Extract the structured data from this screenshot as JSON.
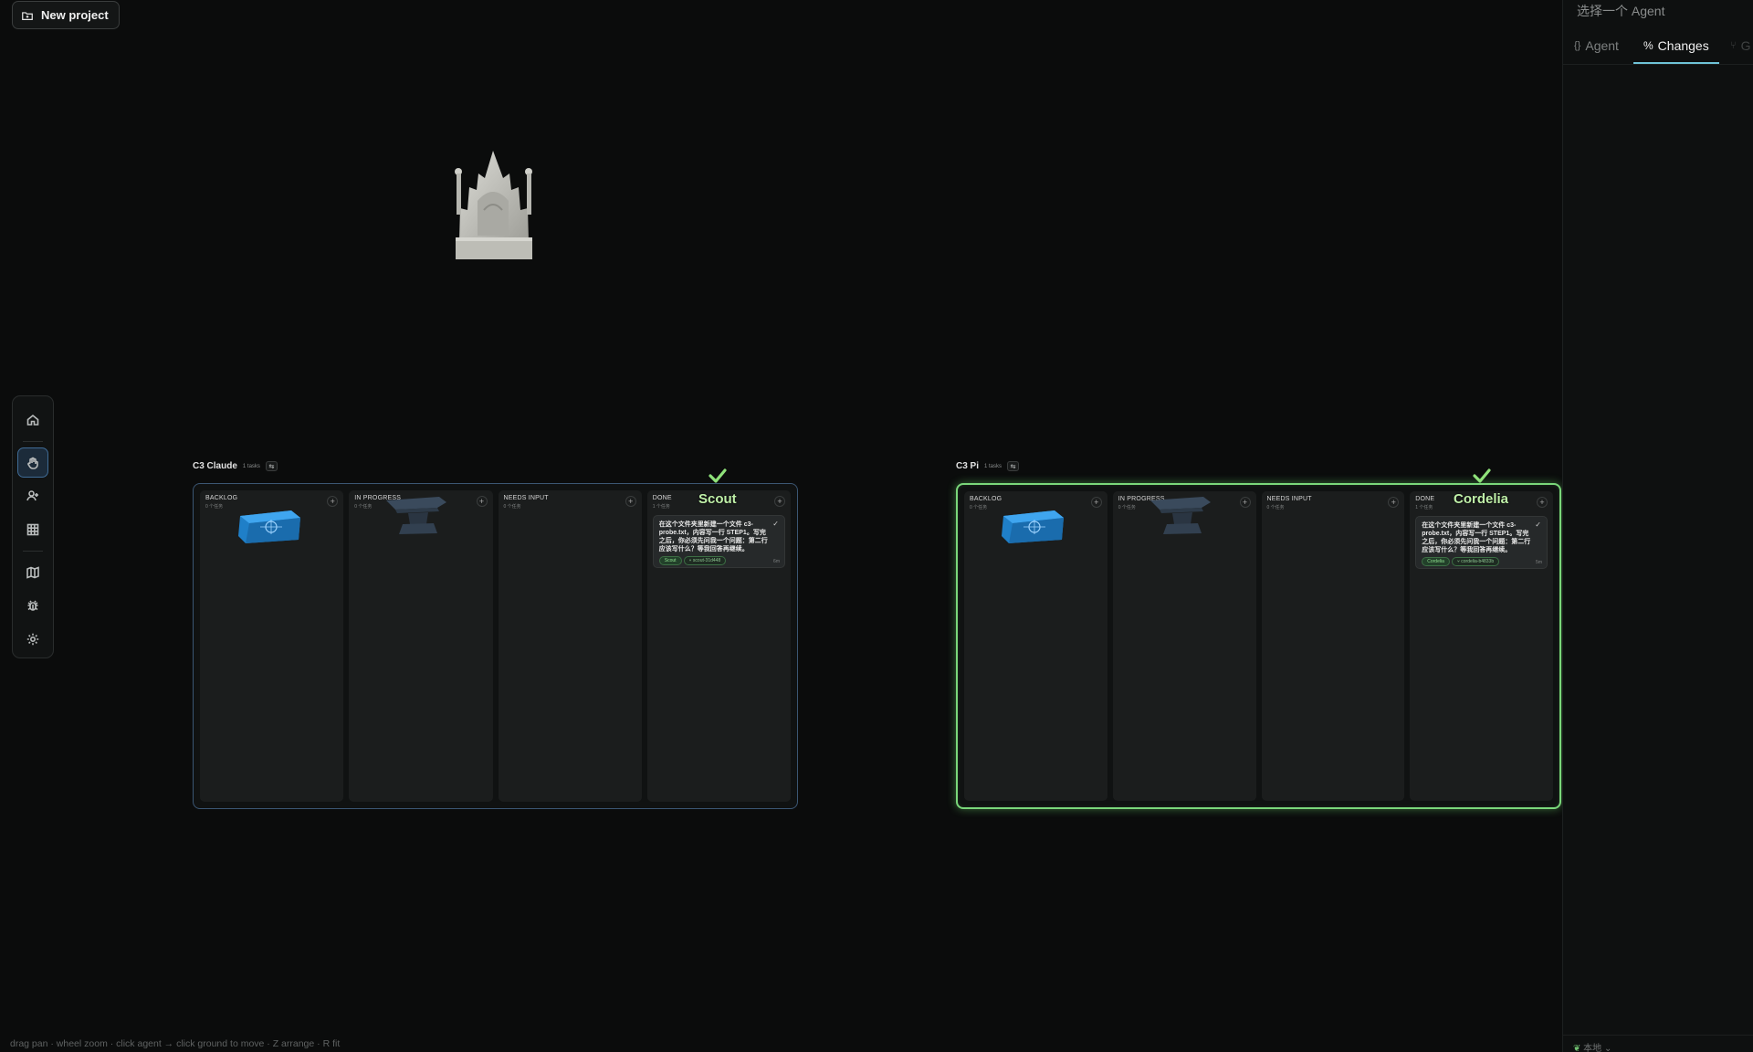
{
  "toolbar": {
    "new_project_label": "New project"
  },
  "tools": [
    {
      "name": "home"
    },
    {
      "name": "hand"
    },
    {
      "name": "add-agent"
    },
    {
      "name": "grid"
    },
    {
      "name": "map"
    },
    {
      "name": "bug"
    },
    {
      "name": "settings"
    }
  ],
  "boards": [
    {
      "title": "C3 Claude",
      "task_count": "1 tasks",
      "columns": [
        {
          "title": "BACKLOG",
          "sub": "0 个任务"
        },
        {
          "title": "IN PROGRESS",
          "sub": "0 个任务"
        },
        {
          "title": "NEEDS INPUT",
          "sub": "0 个任务"
        },
        {
          "title": "DONE",
          "sub": "1 个任务"
        }
      ],
      "agent": "Scout",
      "card": {
        "text": "在这个文件夹里新建一个文件 c3-probe.txt，内容写一行 STEP1。写完之后，你必须先问我一个问题：第二行应该写什么？等我回答再继续。",
        "agent_tag": "Scout",
        "branch_tag": "⑂ scout-31d448",
        "time": "6m"
      }
    },
    {
      "title": "C3 Pi",
      "task_count": "1 tasks",
      "columns": [
        {
          "title": "BACKLOG",
          "sub": "0 个任务"
        },
        {
          "title": "IN PROGRESS",
          "sub": "0 个任务"
        },
        {
          "title": "NEEDS INPUT",
          "sub": "0 个任务"
        },
        {
          "title": "DONE",
          "sub": "1 个任务"
        }
      ],
      "agent": "Cordelia",
      "card": {
        "text": "在这个文件夹里新建一个文件 c3-probe.txt，内容写一行 STEP1。写完之后，你必须先问我一个问题：第二行应该写什么？等我回答再继续。",
        "agent_tag": "Cordelia",
        "branch_tag": "⑂ cordelia-b4833b",
        "time": "5m"
      }
    }
  ],
  "right_panel": {
    "title": "选择一个 Agent",
    "tabs": [
      {
        "label": "Agent",
        "icon": "braces-icon"
      },
      {
        "label": "Changes",
        "icon": "diff-icon"
      },
      {
        "label": "G",
        "icon": "git-icon"
      }
    ],
    "active_tab": "Changes",
    "footer": "本地"
  },
  "hint": "drag pan · wheel zoom · click agent → click ground to move · Z arrange · R fit",
  "colors": {
    "accent_green": "#7ad77a",
    "accent_blue": "#3f6b96",
    "tab_underline": "#6fc3d8"
  }
}
